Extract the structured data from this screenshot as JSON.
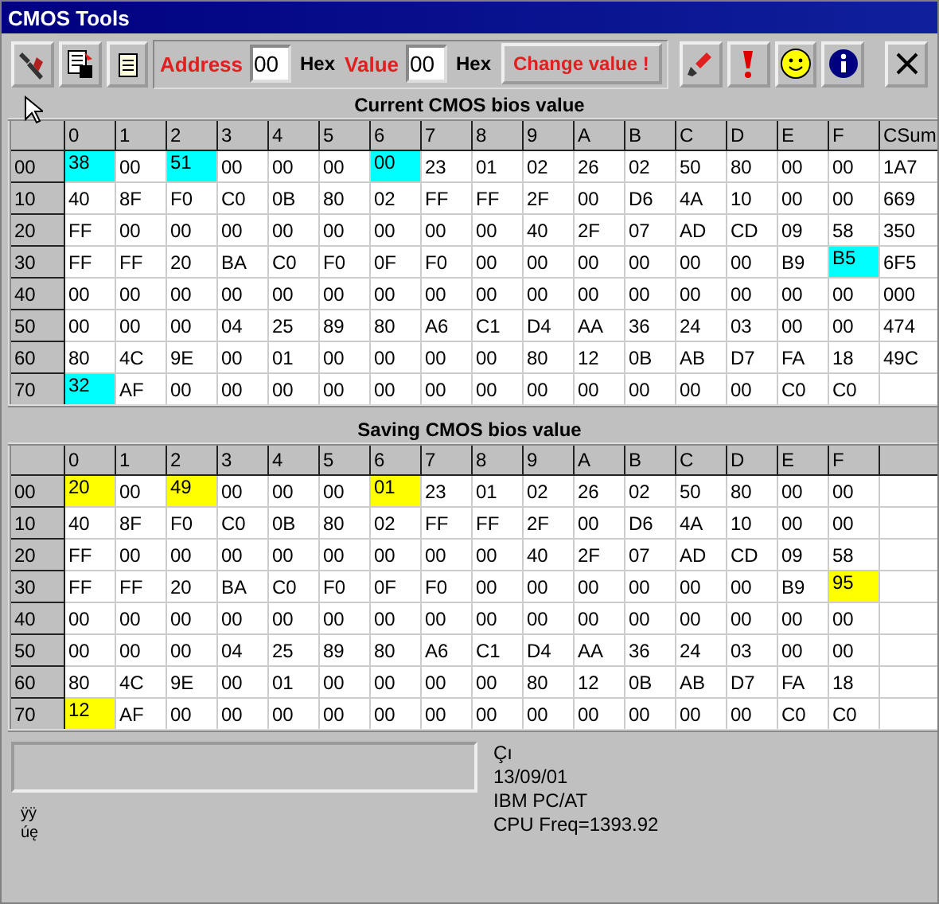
{
  "window": {
    "title": "CMOS Tools"
  },
  "toolbar": {
    "address_label": "Address",
    "address_value": "00",
    "address_unit": "Hex",
    "value_label": "Value",
    "value_value": "00",
    "value_unit": "Hex",
    "change_button": "Change value !"
  },
  "tables": [
    {
      "kind": "current",
      "title": "Current CMOS bios value",
      "columns": [
        "0",
        "1",
        "2",
        "3",
        "4",
        "5",
        "6",
        "7",
        "8",
        "9",
        "A",
        "B",
        "C",
        "D",
        "E",
        "F",
        "CSum"
      ],
      "rows": [
        {
          "label": "00",
          "cells": [
            "38",
            "00",
            "51",
            "00",
            "00",
            "00",
            "00",
            "23",
            "01",
            "02",
            "26",
            "02",
            "50",
            "80",
            "00",
            "00",
            "1A7"
          ],
          "marked": [
            true,
            false,
            true,
            false,
            false,
            false,
            true,
            false,
            false,
            false,
            false,
            false,
            false,
            false,
            false,
            false,
            false
          ]
        },
        {
          "label": "10",
          "cells": [
            "40",
            "8F",
            "F0",
            "C0",
            "0B",
            "80",
            "02",
            "FF",
            "FF",
            "2F",
            "00",
            "D6",
            "4A",
            "10",
            "00",
            "00",
            "669"
          ],
          "marked": [
            false,
            false,
            false,
            false,
            false,
            false,
            false,
            false,
            false,
            false,
            false,
            false,
            false,
            false,
            false,
            false,
            false
          ]
        },
        {
          "label": "20",
          "cells": [
            "FF",
            "00",
            "00",
            "00",
            "00",
            "00",
            "00",
            "00",
            "00",
            "40",
            "2F",
            "07",
            "AD",
            "CD",
            "09",
            "58",
            "350"
          ],
          "marked": [
            false,
            false,
            false,
            false,
            false,
            false,
            false,
            false,
            false,
            false,
            false,
            false,
            false,
            false,
            false,
            false,
            false
          ]
        },
        {
          "label": "30",
          "cells": [
            "FF",
            "FF",
            "20",
            "BA",
            "C0",
            "F0",
            "0F",
            "F0",
            "00",
            "00",
            "00",
            "00",
            "00",
            "00",
            "B9",
            "B5",
            "6F5"
          ],
          "marked": [
            false,
            false,
            false,
            false,
            false,
            false,
            false,
            false,
            false,
            false,
            false,
            false,
            false,
            false,
            false,
            true,
            false
          ]
        },
        {
          "label": "40",
          "cells": [
            "00",
            "00",
            "00",
            "00",
            "00",
            "00",
            "00",
            "00",
            "00",
            "00",
            "00",
            "00",
            "00",
            "00",
            "00",
            "00",
            "000"
          ],
          "marked": [
            false,
            false,
            false,
            false,
            false,
            false,
            false,
            false,
            false,
            false,
            false,
            false,
            false,
            false,
            false,
            false,
            false
          ]
        },
        {
          "label": "50",
          "cells": [
            "00",
            "00",
            "00",
            "04",
            "25",
            "89",
            "80",
            "A6",
            "C1",
            "D4",
            "AA",
            "36",
            "24",
            "03",
            "00",
            "00",
            "474"
          ],
          "marked": [
            false,
            false,
            false,
            false,
            false,
            false,
            false,
            false,
            false,
            false,
            false,
            false,
            false,
            false,
            false,
            false,
            false
          ]
        },
        {
          "label": "60",
          "cells": [
            "80",
            "4C",
            "9E",
            "00",
            "01",
            "00",
            "00",
            "00",
            "00",
            "80",
            "12",
            "0B",
            "AB",
            "D7",
            "FA",
            "18",
            "49C"
          ],
          "marked": [
            false,
            false,
            false,
            false,
            false,
            false,
            false,
            false,
            false,
            false,
            false,
            false,
            false,
            false,
            false,
            false,
            false
          ]
        },
        {
          "label": "70",
          "cells": [
            "32",
            "AF",
            "00",
            "00",
            "00",
            "00",
            "00",
            "00",
            "00",
            "00",
            "00",
            "00",
            "00",
            "00",
            "C0",
            "C0",
            ""
          ],
          "marked": [
            true,
            false,
            false,
            false,
            false,
            false,
            false,
            false,
            false,
            false,
            false,
            false,
            false,
            false,
            false,
            false,
            false
          ]
        }
      ]
    },
    {
      "kind": "saving",
      "title": "Saving CMOS bios value",
      "columns": [
        "0",
        "1",
        "2",
        "3",
        "4",
        "5",
        "6",
        "7",
        "8",
        "9",
        "A",
        "B",
        "C",
        "D",
        "E",
        "F",
        ""
      ],
      "rows": [
        {
          "label": "00",
          "cells": [
            "20",
            "00",
            "49",
            "00",
            "00",
            "00",
            "01",
            "23",
            "01",
            "02",
            "26",
            "02",
            "50",
            "80",
            "00",
            "00",
            ""
          ],
          "marked": [
            true,
            false,
            true,
            false,
            false,
            false,
            true,
            false,
            false,
            false,
            false,
            false,
            false,
            false,
            false,
            false,
            false
          ]
        },
        {
          "label": "10",
          "cells": [
            "40",
            "8F",
            "F0",
            "C0",
            "0B",
            "80",
            "02",
            "FF",
            "FF",
            "2F",
            "00",
            "D6",
            "4A",
            "10",
            "00",
            "00",
            ""
          ],
          "marked": [
            false,
            false,
            false,
            false,
            false,
            false,
            false,
            false,
            false,
            false,
            false,
            false,
            false,
            false,
            false,
            false,
            false
          ]
        },
        {
          "label": "20",
          "cells": [
            "FF",
            "00",
            "00",
            "00",
            "00",
            "00",
            "00",
            "00",
            "00",
            "40",
            "2F",
            "07",
            "AD",
            "CD",
            "09",
            "58",
            ""
          ],
          "marked": [
            false,
            false,
            false,
            false,
            false,
            false,
            false,
            false,
            false,
            false,
            false,
            false,
            false,
            false,
            false,
            false,
            false
          ]
        },
        {
          "label": "30",
          "cells": [
            "FF",
            "FF",
            "20",
            "BA",
            "C0",
            "F0",
            "0F",
            "F0",
            "00",
            "00",
            "00",
            "00",
            "00",
            "00",
            "B9",
            "95",
            ""
          ],
          "marked": [
            false,
            false,
            false,
            false,
            false,
            false,
            false,
            false,
            false,
            false,
            false,
            false,
            false,
            false,
            false,
            true,
            false
          ]
        },
        {
          "label": "40",
          "cells": [
            "00",
            "00",
            "00",
            "00",
            "00",
            "00",
            "00",
            "00",
            "00",
            "00",
            "00",
            "00",
            "00",
            "00",
            "00",
            "00",
            ""
          ],
          "marked": [
            false,
            false,
            false,
            false,
            false,
            false,
            false,
            false,
            false,
            false,
            false,
            false,
            false,
            false,
            false,
            false,
            false
          ]
        },
        {
          "label": "50",
          "cells": [
            "00",
            "00",
            "00",
            "04",
            "25",
            "89",
            "80",
            "A6",
            "C1",
            "D4",
            "AA",
            "36",
            "24",
            "03",
            "00",
            "00",
            ""
          ],
          "marked": [
            false,
            false,
            false,
            false,
            false,
            false,
            false,
            false,
            false,
            false,
            false,
            false,
            false,
            false,
            false,
            false,
            false
          ]
        },
        {
          "label": "60",
          "cells": [
            "80",
            "4C",
            "9E",
            "00",
            "01",
            "00",
            "00",
            "00",
            "00",
            "80",
            "12",
            "0B",
            "AB",
            "D7",
            "FA",
            "18",
            ""
          ],
          "marked": [
            false,
            false,
            false,
            false,
            false,
            false,
            false,
            false,
            false,
            false,
            false,
            false,
            false,
            false,
            false,
            false,
            false
          ]
        },
        {
          "label": "70",
          "cells": [
            "12",
            "AF",
            "00",
            "00",
            "00",
            "00",
            "00",
            "00",
            "00",
            "00",
            "00",
            "00",
            "00",
            "00",
            "C0",
            "C0",
            ""
          ],
          "marked": [
            true,
            false,
            false,
            false,
            false,
            false,
            false,
            false,
            false,
            false,
            false,
            false,
            false,
            false,
            false,
            false,
            false
          ]
        }
      ]
    }
  ],
  "footer": {
    "left_lines": [
      "ÿÿ",
      "úę"
    ],
    "info_lines": [
      "Çı",
      "13/09/01",
      "IBM PC/AT",
      "CPU Freq=1393.92"
    ]
  }
}
